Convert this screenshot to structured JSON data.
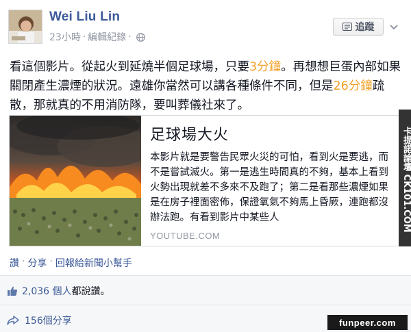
{
  "post": {
    "author": "Wei Liu Lin",
    "time": "23小時",
    "edit_history": "編輯紀錄",
    "follow_label": "追蹤",
    "text_parts": [
      "看這個影片。從起火到延燒半個足球場，只要",
      "3分鐘",
      "。再想想巨蛋內部如果關閉產生濃煙的狀況。遠雄你當然可以講各種條件不同，但是",
      "26分鐘",
      "疏散，那就真的不用消防隊，要叫葬儀社來了。"
    ]
  },
  "link_card": {
    "title": "足球場大火",
    "description": "本影片就是要警告民眾火災的可怕，看到火是要逃，而不是嘗試滅火。第一是逃生時間真的不夠，基本上看到火勢出現就差不多來不及跑了；第二是看那些濃煙如果是在房子裡面密佈，保證氧氣不夠馬上昏厥，連跑都沒辦法跑。有看到影片中某些人",
    "domain": "YOUTUBE.COM"
  },
  "actions": {
    "like": "讚",
    "share": "分享",
    "reply_helper": "回報給新聞小幫手"
  },
  "feedback": {
    "like_count": "2,036 個人",
    "like_suffix": "都說讚。",
    "share_count": "156個分享"
  },
  "watermarks": {
    "side": "卡提諾論壇 CK101.COM",
    "bottom": "funpeer.com"
  },
  "colors": {
    "link": "#3b5998",
    "highlight": "#f3a12a",
    "muted": "#9197a3"
  }
}
